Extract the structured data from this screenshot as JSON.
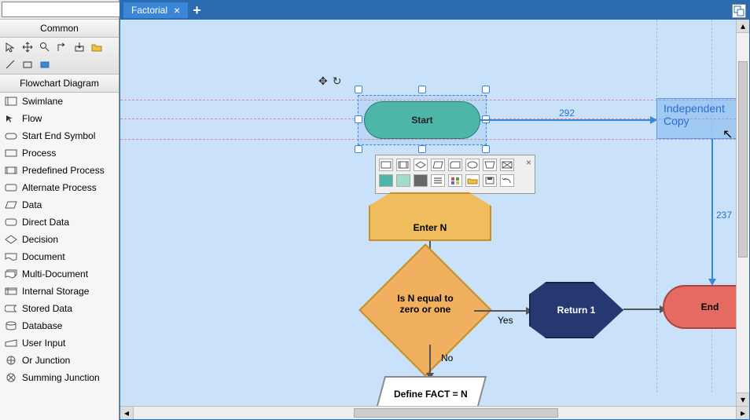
{
  "sidebar": {
    "common_header": "Common",
    "flowchart_header": "Flowchart Diagram",
    "items": [
      {
        "label": "Swimlane"
      },
      {
        "label": "Flow"
      },
      {
        "label": "Start End Symbol"
      },
      {
        "label": "Process"
      },
      {
        "label": "Predefined Process"
      },
      {
        "label": "Alternate Process"
      },
      {
        "label": "Data"
      },
      {
        "label": "Direct Data"
      },
      {
        "label": "Decision"
      },
      {
        "label": "Document"
      },
      {
        "label": "Multi-Document"
      },
      {
        "label": "Internal Storage"
      },
      {
        "label": "Stored Data"
      },
      {
        "label": "Database"
      },
      {
        "label": "User Input"
      },
      {
        "label": "Or Junction"
      },
      {
        "label": "Summing Junction"
      }
    ]
  },
  "search": {
    "placeholder": ""
  },
  "tabs": {
    "active": "Factorial"
  },
  "canvas": {
    "start": "Start",
    "independent_copy_l1": "Independent",
    "independent_copy_l2": "Copy",
    "enter_n": "Enter N",
    "decision_l1": "Is N equal to",
    "decision_l2": "zero or one",
    "return1": "Return 1",
    "end": "End",
    "define": "Define FACT = N",
    "yes": "Yes",
    "no": "No",
    "dim_h": "292",
    "dim_v": "237"
  }
}
